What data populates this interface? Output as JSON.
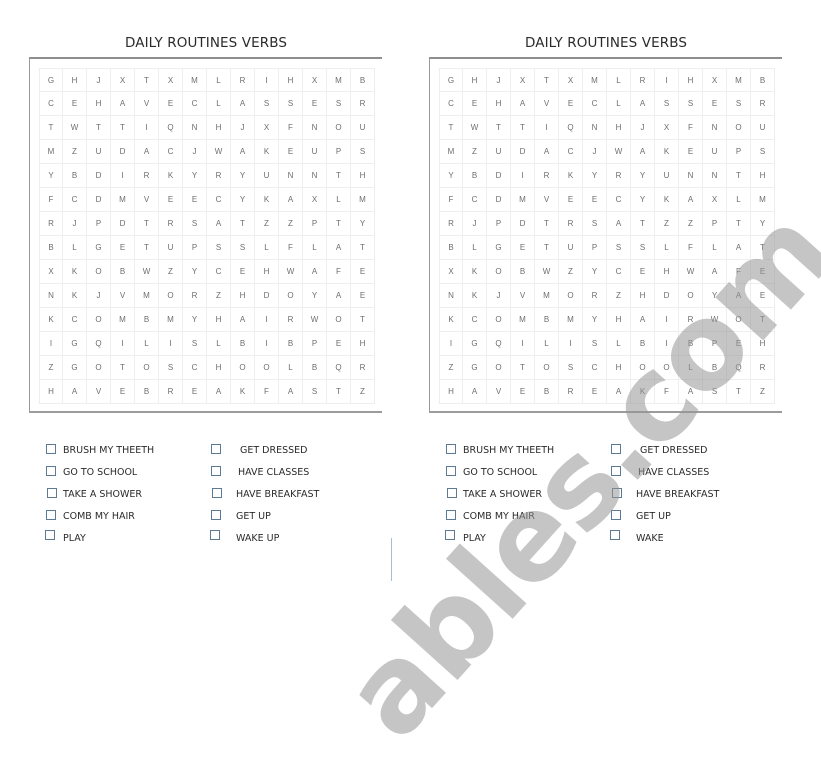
{
  "title": "DAILY ROUTINES VERBS",
  "grid": [
    [
      "G",
      "H",
      "J",
      "X",
      "T",
      "X",
      "M",
      "L",
      "R",
      "I",
      "H",
      "X",
      "M",
      "B"
    ],
    [
      "C",
      "E",
      "H",
      "A",
      "V",
      "E",
      "C",
      "L",
      "A",
      "S",
      "S",
      "E",
      "S",
      "R"
    ],
    [
      "T",
      "W",
      "T",
      "T",
      "I",
      "Q",
      "N",
      "H",
      "J",
      "X",
      "F",
      "N",
      "O",
      "U"
    ],
    [
      "M",
      "Z",
      "U",
      "D",
      "A",
      "C",
      "J",
      "W",
      "A",
      "K",
      "E",
      "U",
      "P",
      "S"
    ],
    [
      "Y",
      "B",
      "D",
      "I",
      "R",
      "K",
      "Y",
      "R",
      "Y",
      "U",
      "N",
      "N",
      "T",
      "H"
    ],
    [
      "F",
      "C",
      "D",
      "M",
      "V",
      "E",
      "E",
      "C",
      "Y",
      "K",
      "A",
      "X",
      "L",
      "M"
    ],
    [
      "R",
      "J",
      "P",
      "D",
      "T",
      "R",
      "S",
      "A",
      "T",
      "Z",
      "Z",
      "P",
      "T",
      "Y"
    ],
    [
      "B",
      "L",
      "G",
      "E",
      "T",
      "U",
      "P",
      "S",
      "S",
      "L",
      "F",
      "L",
      "A",
      "T"
    ],
    [
      "X",
      "K",
      "O",
      "B",
      "W",
      "Z",
      "Y",
      "C",
      "E",
      "H",
      "W",
      "A",
      "F",
      "E"
    ],
    [
      "N",
      "K",
      "J",
      "V",
      "M",
      "O",
      "R",
      "Z",
      "H",
      "D",
      "O",
      "Y",
      "A",
      "E"
    ],
    [
      "K",
      "C",
      "O",
      "M",
      "B",
      "M",
      "Y",
      "H",
      "A",
      "I",
      "R",
      "W",
      "O",
      "T"
    ],
    [
      "I",
      "G",
      "Q",
      "I",
      "L",
      "I",
      "S",
      "L",
      "B",
      "I",
      "B",
      "P",
      "E",
      "H"
    ],
    [
      "Z",
      "G",
      "O",
      "T",
      "O",
      "S",
      "C",
      "H",
      "O",
      "O",
      "L",
      "B",
      "Q",
      "R"
    ],
    [
      "H",
      "A",
      "V",
      "E",
      "B",
      "R",
      "E",
      "A",
      "K",
      "F",
      "A",
      "S",
      "T",
      "Z"
    ]
  ],
  "panels": [
    {
      "name": "left",
      "words_col1": [
        "BRUSH MY THEETH",
        "GO TO SCHOOL",
        "TAKE A SHOWER",
        "COMB MY HAIR",
        "PLAY"
      ],
      "words_col2": [
        "GET DRESSED",
        "HAVE CLASSES",
        "HAVE BREAKFAST",
        "GET UP",
        "WAKE UP"
      ]
    },
    {
      "name": "right",
      "words_col1": [
        "BRUSH MY THEETH",
        "GO TO SCHOOL",
        "TAKE A SHOWER",
        "COMB MY HAIR",
        "PLAY"
      ],
      "words_col2": [
        "GET DRESSED",
        "HAVE CLASSES",
        "HAVE BREAKFAST",
        "GET UP",
        "WAKE"
      ]
    }
  ],
  "watermark": "ables.com",
  "colors": {
    "checkbox_border": "#5d7a94",
    "grid_letter": "#6e6e6e",
    "frame": "#8e8e8e"
  }
}
